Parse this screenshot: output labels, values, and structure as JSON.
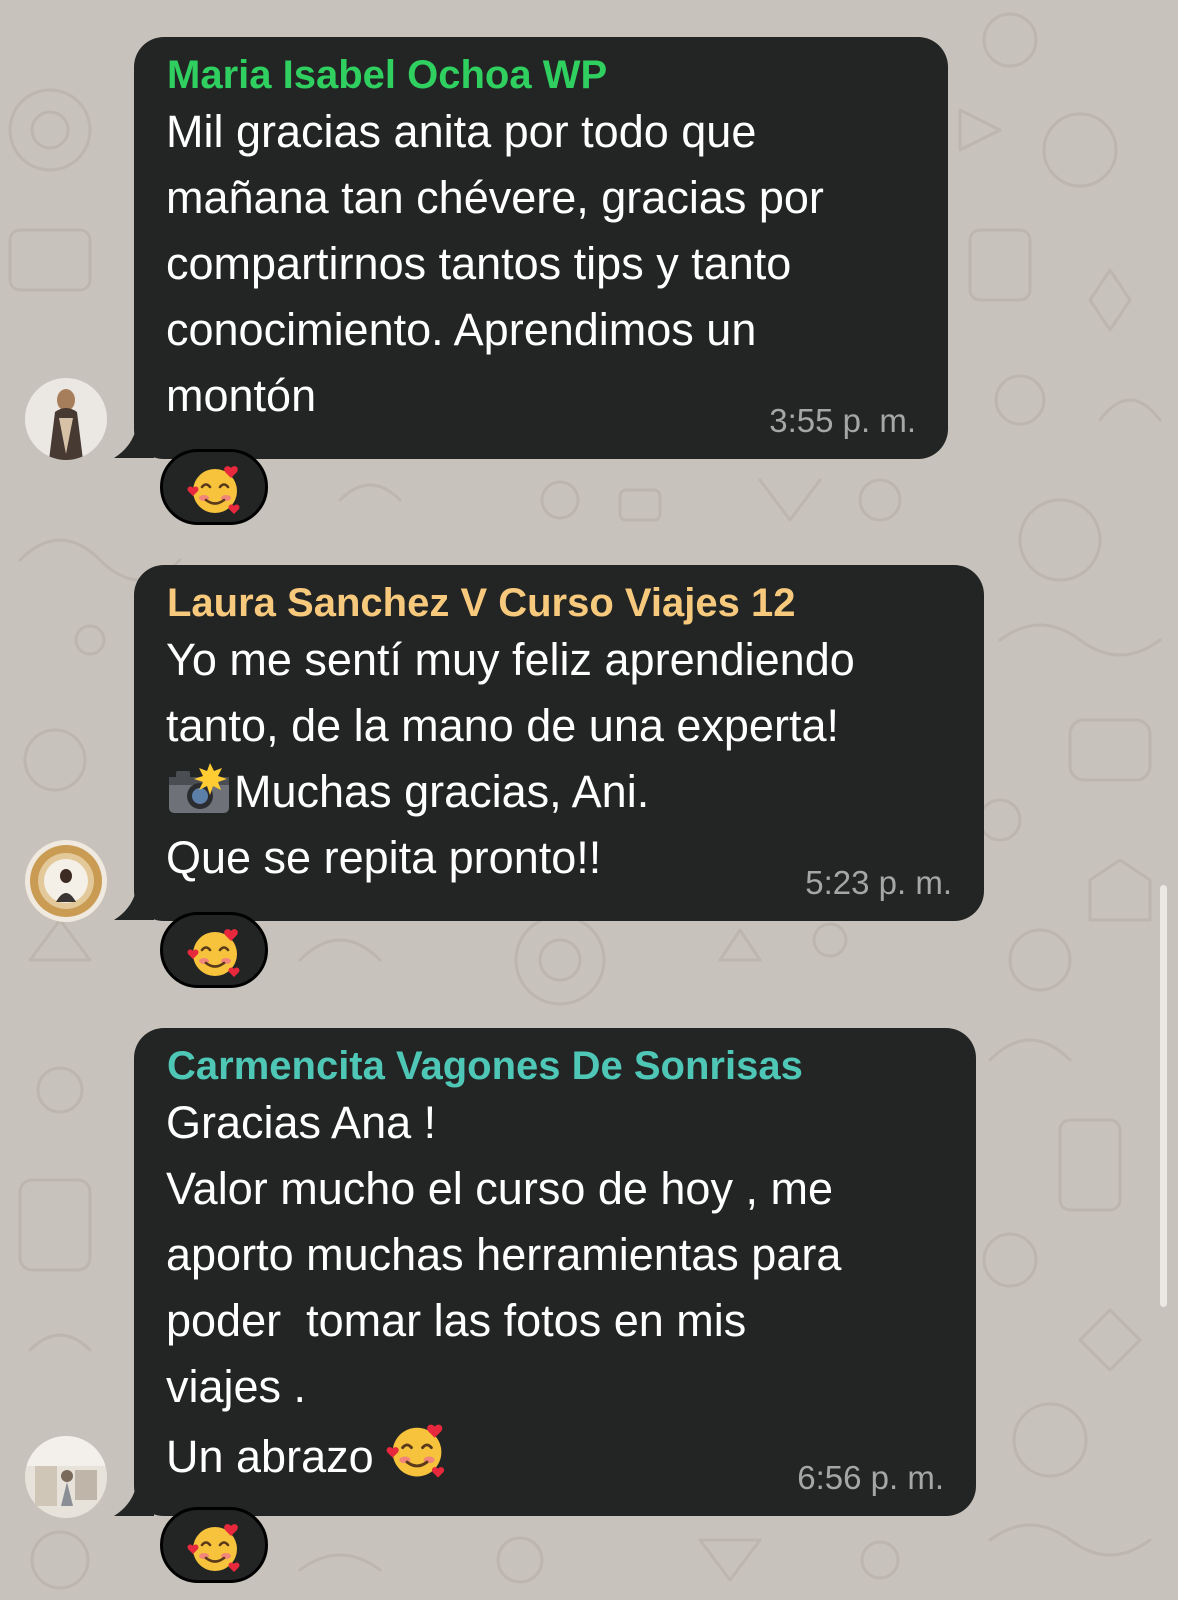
{
  "colors": {
    "wallpaper": "#c7c2bb",
    "bubble": "#232524",
    "message_text": "#ffffff",
    "timestamp": "#a6a6a6"
  },
  "messages": [
    {
      "sender": "Maria Isabel Ochoa WP",
      "sender_color": "#2fd05f",
      "text": "Mil gracias anita por todo que\nmañana tan chévere, gracias por\ncompartirnos tantos tips y tanto\nconocimiento. Aprendimos un\nmontón",
      "time": "3:55 p. m.",
      "reaction": "smiling-face-with-hearts-emoji",
      "avatar": "profile-photo-avatar"
    },
    {
      "sender": "Laura Sanchez V Curso Viajes 12",
      "sender_color": "#f7c97d",
      "text_lines": [
        "Yo me sentí muy feliz aprendiendo",
        "tanto, de la mano de una experta!",
        "Muchas gracias, Ani.",
        "Que se repita pronto!!"
      ],
      "line3_prefix_icon": "camera-with-flash-emoji",
      "time": "5:23 p. m.",
      "reaction": "smiling-face-with-hearts-emoji",
      "avatar": "mirror-selfie-avatar"
    },
    {
      "sender": "Carmencita Vagones De Sonrisas",
      "sender_color": "#4fc7b6",
      "text": "Gracias Ana !\nValor mucho el curso de hoy , me\naporto muchas herramientas para\npoder  tomar las fotos en mis\nviajes .",
      "last_line": "Un abrazo",
      "last_line_icon": "smiling-face-with-hearts-emoji",
      "time": "6:56 p. m.",
      "reaction": "smiling-face-with-hearts-emoji",
      "avatar": "room-photo-avatar"
    }
  ]
}
